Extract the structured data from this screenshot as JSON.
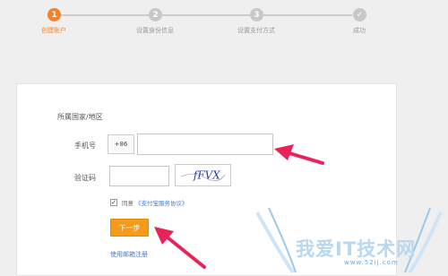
{
  "steps": [
    {
      "number": "1",
      "label": "创建账户",
      "active": true
    },
    {
      "number": "2",
      "label": "设置身份信息",
      "active": false
    },
    {
      "number": "3",
      "label": "设置支付方式",
      "active": false
    },
    {
      "number": "✓",
      "label": "成功",
      "active": false
    }
  ],
  "form": {
    "region_label": "所属国家/地区",
    "phone_label": "手机号",
    "phone_prefix": "+86",
    "phone_value": "",
    "code_label": "验证码",
    "code_value": "",
    "captcha_text": "fFVX",
    "agree_checked": true,
    "agree_text": "同意",
    "agree_link": "《支付宝服务协议》",
    "next_button": "下一步",
    "email_register_link": "使用邮箱注册"
  },
  "watermark": {
    "text": "我爱IT技术网",
    "url": "www.52ij.com"
  },
  "colors": {
    "accent": "#f5812a",
    "button": "#f59b1c",
    "link": "#3b7dd8",
    "arrow": "#e8235a"
  }
}
